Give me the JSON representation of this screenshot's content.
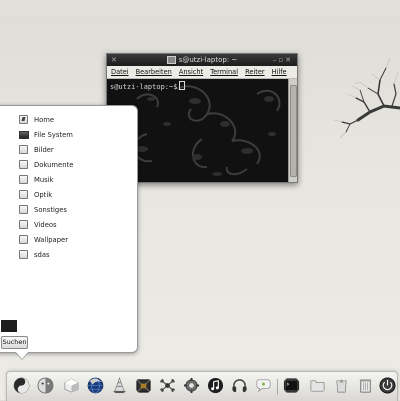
{
  "terminal": {
    "title": "s@utzi-laptop: ~",
    "menu": [
      "Datei",
      "Bearbeiten",
      "Ansicht",
      "Terminal",
      "Reiter",
      "Hilfe"
    ],
    "prompt": "s@utzi-laptop:~$"
  },
  "places": {
    "items": [
      {
        "label": "Home",
        "icon": "home-folder-icon"
      },
      {
        "label": "File System",
        "icon": "drive-icon"
      },
      {
        "label": "Bilder",
        "icon": "folder-icon"
      },
      {
        "label": "Dokumente",
        "icon": "folder-icon"
      },
      {
        "label": "Musik",
        "icon": "folder-icon"
      },
      {
        "label": "Optik",
        "icon": "folder-icon"
      },
      {
        "label": "Sonstiges",
        "icon": "folder-icon"
      },
      {
        "label": "Videos",
        "icon": "folder-icon"
      },
      {
        "label": "Wallpaper",
        "icon": "folder-icon"
      },
      {
        "label": "sdas",
        "icon": "folder-icon"
      }
    ],
    "search_label": "Suchen"
  },
  "dock": {
    "items": [
      "places-icon",
      "finder-icon",
      "cube-icon",
      "browser-icon",
      "media-player-icon",
      "package-icon",
      "network-icon",
      "settings-icon",
      "music-icon",
      "headphones-icon",
      "chat-icon",
      "terminal-icon",
      "trash-icon",
      "recycle-icon",
      "disk-icon",
      "power-icon"
    ]
  }
}
